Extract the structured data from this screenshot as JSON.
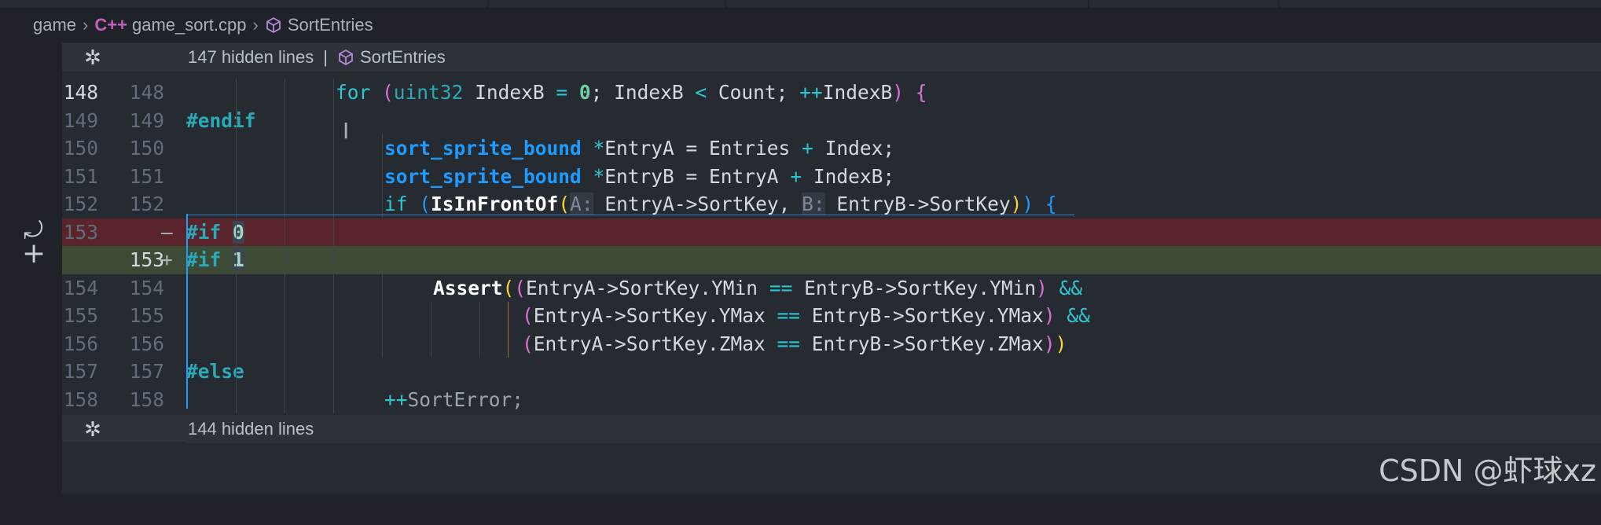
{
  "breadcrumb": {
    "root": "game",
    "file_icon": "C++",
    "file": "game_sort.cpp",
    "symbol": "SortEntries"
  },
  "fold_top": {
    "label": "147 hidden lines",
    "separator": "|",
    "symbol": "SortEntries"
  },
  "fold_bottom": {
    "label": "144 hidden lines"
  },
  "rows": [
    {
      "old": "148",
      "new": "148"
    },
    {
      "old": "149",
      "new": "149"
    },
    {
      "old": "150",
      "new": "150"
    },
    {
      "old": "151",
      "new": "151"
    },
    {
      "old": "152",
      "new": "152"
    },
    {
      "old": "153",
      "new": "",
      "marker": "—"
    },
    {
      "old": "",
      "new": "153",
      "marker": "+"
    },
    {
      "old": "154",
      "new": "154"
    },
    {
      "old": "155",
      "new": "155"
    },
    {
      "old": "156",
      "new": "156"
    },
    {
      "old": "157",
      "new": "157"
    },
    {
      "old": "158",
      "new": "158"
    }
  ],
  "code": {
    "l148": {
      "kw": "for",
      "open": "(",
      "type": "uint32",
      "a": " IndexB ",
      "eq": "=",
      "zero": "0",
      "b": "; IndexB ",
      "lt": "<",
      "c": " Count; ",
      "inc": "++",
      "d": "IndexB",
      "close": ")",
      "brace": " {"
    },
    "l149": "#endif",
    "l150": {
      "type": "sort_sprite_bound",
      "star": "*",
      "rest": "EntryA = Entries ",
      "plus": "+",
      "tail": " Index;"
    },
    "l151": {
      "type": "sort_sprite_bound",
      "star": "*",
      "rest": "EntryB = EntryA ",
      "plus": "+",
      "tail": " IndexB;"
    },
    "l152": {
      "kw": "if",
      "open": "(",
      "fn": "IsInFrontOf",
      "open2": "(",
      "hintA": "A:",
      "argA": " EntryA->SortKey, ",
      "hintB": "B:",
      "argB": " EntryB->SortKey",
      "close2": ")",
      "close": ")",
      "brace": " {"
    },
    "l153del": {
      "pp": "#if",
      "num": "0"
    },
    "l153add": {
      "pp": "#if",
      "num": "1"
    },
    "l154": {
      "fn": "Assert",
      "open": "(",
      "open2": "(",
      "lhs": "EntryA->SortKey.YMin ",
      "eq": "==",
      "rhs": " EntryB->SortKey.YMin",
      "close2": ")",
      "and": " &&"
    },
    "l155": {
      "open2": "(",
      "lhs": "EntryA->SortKey.YMax ",
      "eq": "==",
      "rhs": " EntryB->SortKey.YMax",
      "close2": ")",
      "and": " &&"
    },
    "l156": {
      "open2": "(",
      "lhs": "EntryA->SortKey.ZMax ",
      "eq": "==",
      "rhs": " EntryB->SortKey.ZMax",
      "close2": ")",
      "close": ")"
    },
    "l157": "#else",
    "l158": {
      "inc": "++",
      "rest": "SortError;"
    }
  },
  "gutter_icons": {
    "revert": "revert-arrow-icon",
    "add": "plus-icon"
  },
  "watermark": "CSDN @虾球xz"
}
